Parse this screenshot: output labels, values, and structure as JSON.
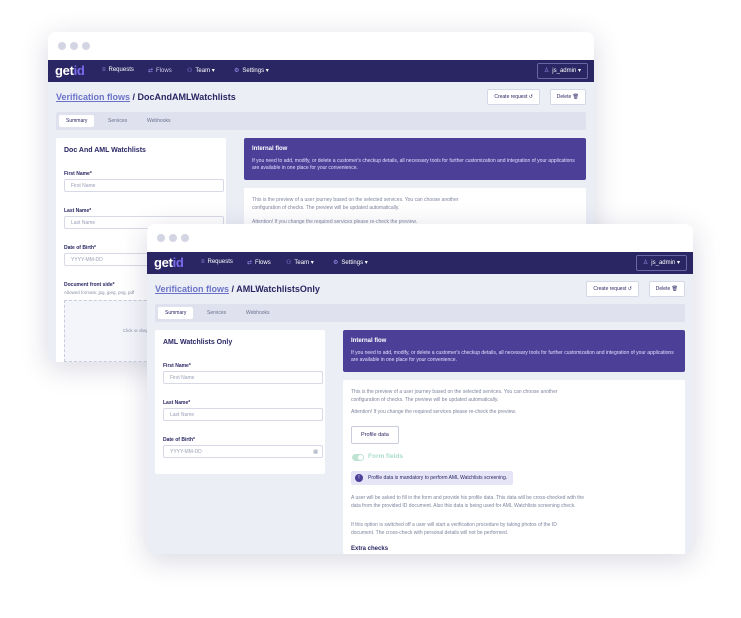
{
  "back": {
    "logo": {
      "brand": "get",
      "accent": "id"
    },
    "nav": {
      "requests": "Requests",
      "flows": "Flows",
      "team": "Team ▾",
      "settings": "Settings ▾",
      "user": "js_admin ▾"
    },
    "breadcrumb": {
      "link": "Verification flows",
      "current": " / DocAndAMLWatchlists"
    },
    "actions": {
      "create": "Create request ↺",
      "delete": "Delete 🗑"
    },
    "tabs": [
      "Summary",
      "Services",
      "Webhooks"
    ],
    "form": {
      "title": "Doc And AML Watchlists",
      "first_name_label": "First Name*",
      "first_name_placeholder": "First Name",
      "last_name_label": "Last Name*",
      "last_name_placeholder": "Last Name",
      "dob_label": "Date of Birth*",
      "dob_placeholder": "YYYY-MM-DD",
      "doc_label": "Document front side*",
      "doc_hint": "Allowed formats: jpg, jpeg, png, pdf",
      "drop_text": "Click or drag and drop"
    },
    "banner": {
      "title": "Internal flow",
      "text": "If you need to add, modify, or delete a customer's checkup details, all necessary tools for further customization and integration of your applications are available in one place for your convenience."
    },
    "preview": {
      "text1": "This is the preview of a user journey based on the selected services. You can choose another configuration of checks. The preview will be updated automatically.",
      "text2": "Attention! If you change the required services please re-check the preview."
    }
  },
  "front": {
    "logo": {
      "brand": "get",
      "accent": "id"
    },
    "nav": {
      "requests": "Requests",
      "flows": "Flows",
      "team": "Team ▾",
      "settings": "Settings ▾",
      "user": "js_admin ▾"
    },
    "breadcrumb": {
      "link": "Verification flows",
      "current": " / AMLWatchlistsOnly"
    },
    "actions": {
      "create": "Create request ↺",
      "delete": "Delete 🗑"
    },
    "tabs": [
      "Summary",
      "Services",
      "Webhooks"
    ],
    "form": {
      "title": "AML Watchlists Only",
      "first_name_label": "First Name*",
      "first_name_placeholder": "First Name",
      "last_name_label": "Last Name*",
      "last_name_placeholder": "Last Name",
      "dob_label": "Date of Birth*",
      "dob_placeholder": "YYYY-MM-DD"
    },
    "banner": {
      "title": "Internal flow",
      "text": "If you need to add, modify, or delete a customer's checkup details, all necessary tools for further customization and integration of your applications are available in one place for your convenience."
    },
    "preview": {
      "text1": "This is the preview of a user journey based on the selected services. You can choose another configuration of checks. The preview will be updated automatically.",
      "text2": "Attention! If you change the required services please re-check the preview.",
      "profile_button": "Profile data",
      "form_fields_toggle": "Form fields",
      "info": "Profile data is mandatory to perform AML Watchlists screening.",
      "text3": "A user will be asked to fill in the form and provide his profile data. This data will be cross-checked with the data from the provided ID document. Also this data is being used for AML Watchlists screening check.",
      "text4": "If this option is switched off a user will start a verification procedure by taking photos of the ID document. The cross-check with personal details will not be performed.",
      "cut_heading": "Extra checks"
    }
  },
  "icons": {
    "menu": "menu-icon",
    "flows": "flows-icon",
    "team": "team-icon",
    "settings": "gear-icon",
    "user": "user-icon",
    "calendar": "calendar-icon",
    "info": "info-icon"
  },
  "colors": {
    "nav": "#2a2663",
    "accent": "#7b6df0",
    "banner": "#4b3f98",
    "background": "#eceef6"
  }
}
